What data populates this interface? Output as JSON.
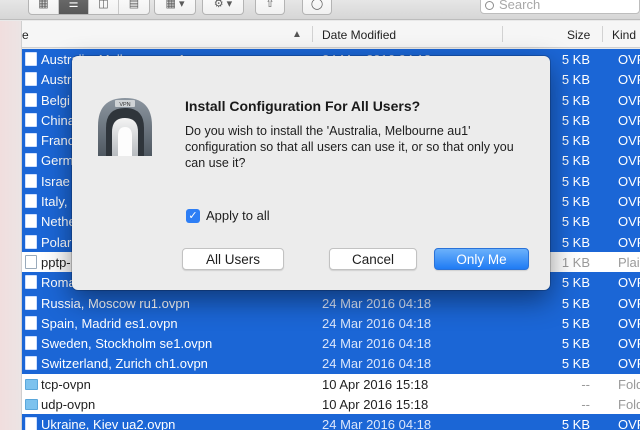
{
  "toolbar": {
    "search_placeholder": "Search"
  },
  "columns": {
    "name_tail": "e",
    "date": "Date Modified",
    "size": "Size",
    "kind": "Kind"
  },
  "rows": [
    {
      "name": "Australia, Melbourne au1",
      "date": "24 Mar 2016 04:18",
      "size": "5 KB",
      "kind": "OVP",
      "selected": true,
      "icon": "file"
    },
    {
      "name": "Austr",
      "date": "",
      "size": "5 KB",
      "kind": "OVP",
      "selected": true,
      "icon": "file"
    },
    {
      "name": "Belgi",
      "date": "",
      "size": "5 KB",
      "kind": "OVP",
      "selected": true,
      "icon": "file"
    },
    {
      "name": "China",
      "date": "",
      "size": "5 KB",
      "kind": "OVP",
      "selected": true,
      "icon": "file"
    },
    {
      "name": "Franc",
      "date": "",
      "size": "5 KB",
      "kind": "OVP",
      "selected": true,
      "icon": "file"
    },
    {
      "name": "Germ",
      "date": "",
      "size": "5 KB",
      "kind": "OVP",
      "selected": true,
      "icon": "file"
    },
    {
      "name": "Israe",
      "date": "",
      "size": "5 KB",
      "kind": "OVP",
      "selected": true,
      "icon": "file"
    },
    {
      "name": "Italy,",
      "date": "",
      "size": "5 KB",
      "kind": "OVP",
      "selected": true,
      "icon": "file"
    },
    {
      "name": "Nethe",
      "date": "",
      "size": "5 KB",
      "kind": "OVP",
      "selected": true,
      "icon": "file"
    },
    {
      "name": "Polar",
      "date": "",
      "size": "5 KB",
      "kind": "OVP",
      "selected": true,
      "icon": "file"
    },
    {
      "name": "pptp-",
      "date": "",
      "size": "1 KB",
      "kind": "Plai",
      "selected": false,
      "icon": "file"
    },
    {
      "name": "Roma",
      "date": "",
      "size": "5 KB",
      "kind": "OVP",
      "selected": true,
      "icon": "file"
    },
    {
      "name": "Russia, Moscow ru1.ovpn",
      "date": "24 Mar 2016 04:18",
      "size": "5 KB",
      "kind": "OVP",
      "selected": true,
      "icon": "file"
    },
    {
      "name": "Spain, Madrid es1.ovpn",
      "date": "24 Mar 2016 04:18",
      "size": "5 KB",
      "kind": "OVP",
      "selected": true,
      "icon": "file"
    },
    {
      "name": "Sweden, Stockholm se1.ovpn",
      "date": "24 Mar 2016 04:18",
      "size": "5 KB",
      "kind": "OVP",
      "selected": true,
      "icon": "file"
    },
    {
      "name": "Switzerland, Zurich ch1.ovpn",
      "date": "24 Mar 2016 04:18",
      "size": "5 KB",
      "kind": "OVP",
      "selected": true,
      "icon": "file"
    },
    {
      "name": "tcp-ovpn",
      "date": "10 Apr 2016 15:18",
      "size": "--",
      "kind": "Fold",
      "selected": false,
      "icon": "folder"
    },
    {
      "name": "udp-ovpn",
      "date": "10 Apr 2016 15:18",
      "size": "--",
      "kind": "Fold",
      "selected": false,
      "icon": "folder"
    },
    {
      "name": "Ukraine, Kiev ua2.ovpn",
      "date": "24 Mar 2016 04:18",
      "size": "5 KB",
      "kind": "OVP",
      "selected": true,
      "icon": "file"
    }
  ],
  "dialog": {
    "title": "Install Configuration For All Users?",
    "message": "Do you wish to install the 'Australia, Melbourne au1' configuration so that all users can use it, or so that only you can use it?",
    "icon_label": "VPN",
    "checkbox_label": "Apply to all",
    "checkbox_checked": true,
    "buttons": {
      "all_users": "All Users",
      "cancel": "Cancel",
      "only_me": "Only Me"
    }
  },
  "colors": {
    "selection": "#1b66d6",
    "primary_button": "#1f7bf4"
  }
}
